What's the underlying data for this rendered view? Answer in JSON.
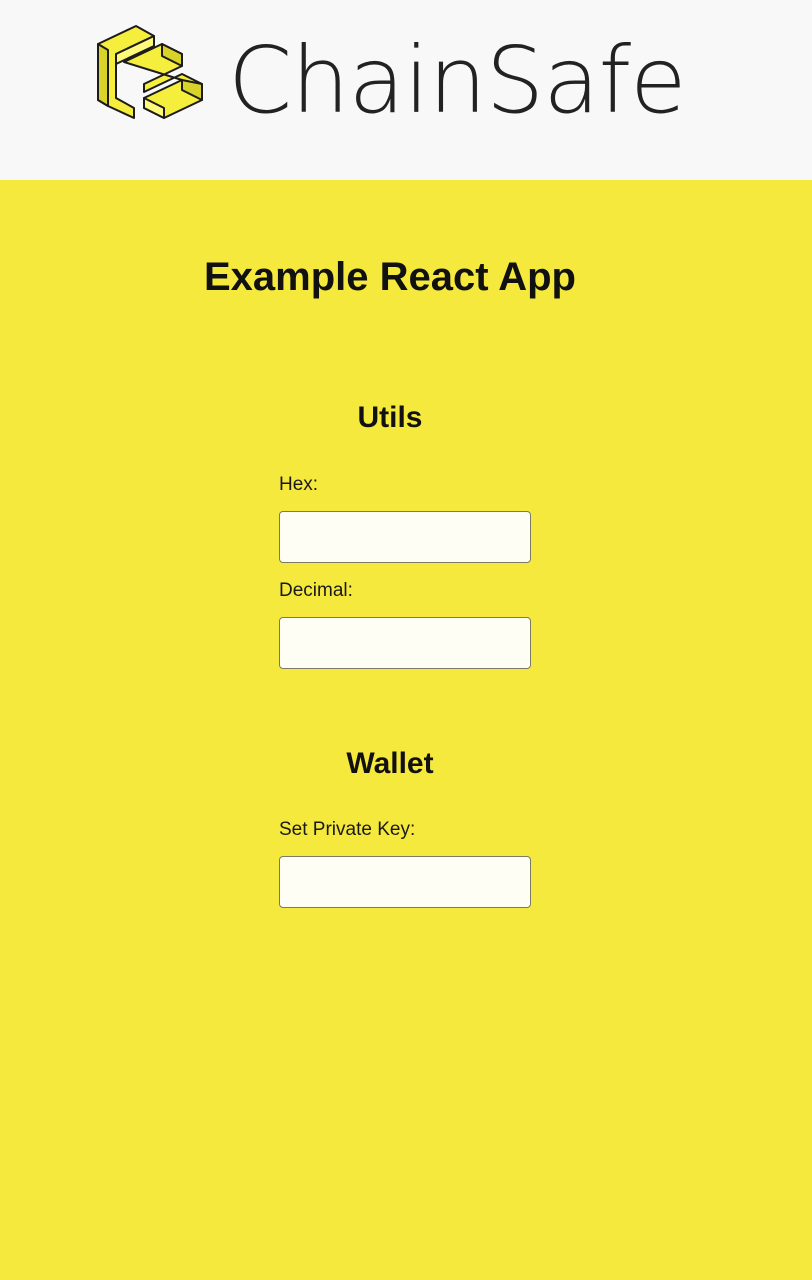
{
  "header": {
    "brand_name": "ChainSafe",
    "logo_icon": "chainsafe-logo-icon",
    "background": "#f8f8f8"
  },
  "colors": {
    "page_background": "#f6e93d",
    "logo_yellow": "#f6ee3c",
    "text": "#111111"
  },
  "main": {
    "title": "Example React App",
    "utils": {
      "title": "Utils",
      "hex_label": "Hex:",
      "hex_value": "",
      "decimal_label": "Decimal:",
      "decimal_value": ""
    },
    "wallet": {
      "title": "Wallet",
      "private_key_label": "Set Private Key:",
      "private_key_value": ""
    }
  }
}
